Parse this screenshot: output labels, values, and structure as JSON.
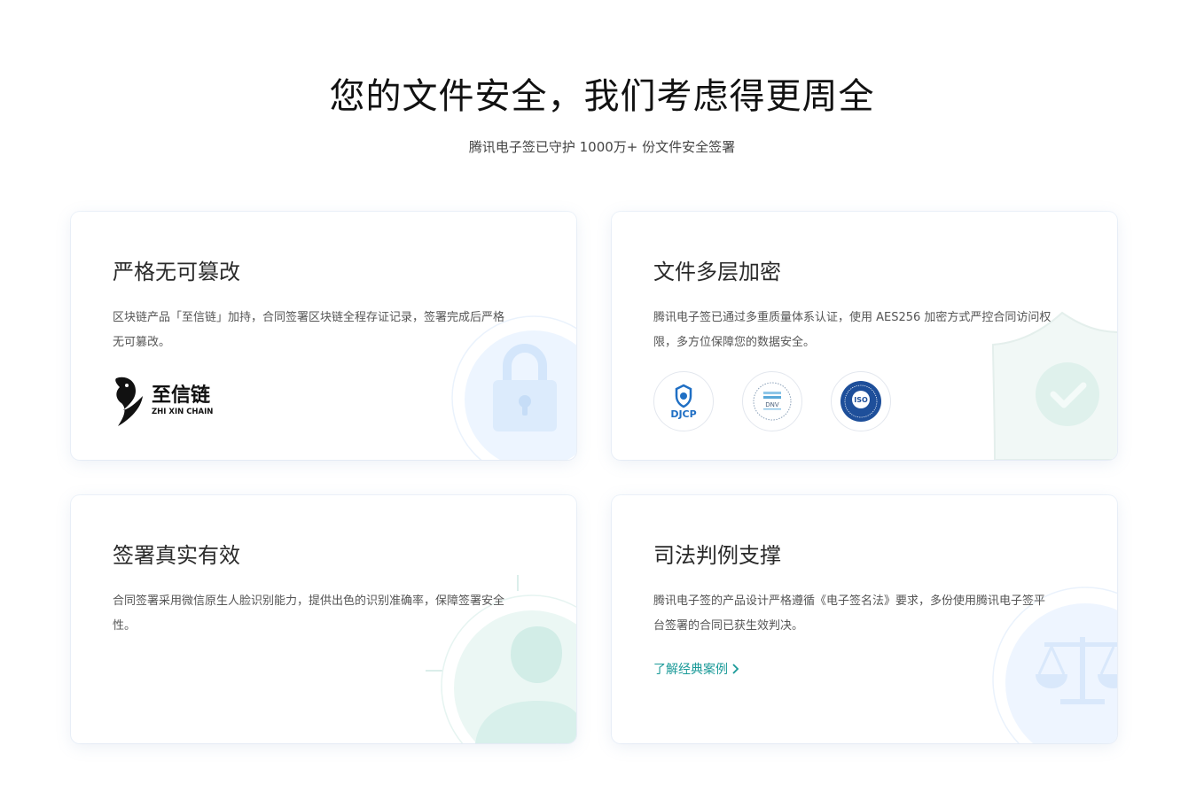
{
  "header": {
    "title": "您的文件安全，我们考虑得更周全",
    "subtitle": "腾讯电子签已守护 1000万+ 份文件安全签署"
  },
  "cards": [
    {
      "title": "严格无可篡改",
      "desc": "区块链产品「至信链」加持，合同签署区块链全程存证记录，签署完成后严格无可篡改。",
      "logo_text": "至信链",
      "logo_sub": "ZHI XIN CHAIN",
      "deco_icon": "lock-icon"
    },
    {
      "title": "文件多层加密",
      "desc": "腾讯电子签已通过多重质量体系认证，使用 AES256 加密方式严控合同访问权限，多方位保障您的数据安全。",
      "certs": [
        {
          "name": "djcp-badge",
          "label": "DJCP"
        },
        {
          "name": "dnv-badge",
          "label": "DNV"
        },
        {
          "name": "iso-badge",
          "label": "ISO"
        }
      ],
      "deco_icon": "shield-check-icon"
    },
    {
      "title": "签署真实有效",
      "desc": "合同签署采用微信原生人脸识别能力，提供出色的识别准确率，保障签署安全性。",
      "deco_icon": "person-icon"
    },
    {
      "title": "司法判例支撑",
      "desc": "腾讯电子签的产品设计严格遵循《电子签名法》要求，多份使用腾讯电子签平台签署的合同已获生效判决。",
      "link": "了解经典案例",
      "deco_icon": "scale-icon"
    }
  ],
  "colors": {
    "accent": "#1a9a98",
    "deco_blue": "#e6f1ff",
    "deco_teal": "#e3f4f1"
  }
}
